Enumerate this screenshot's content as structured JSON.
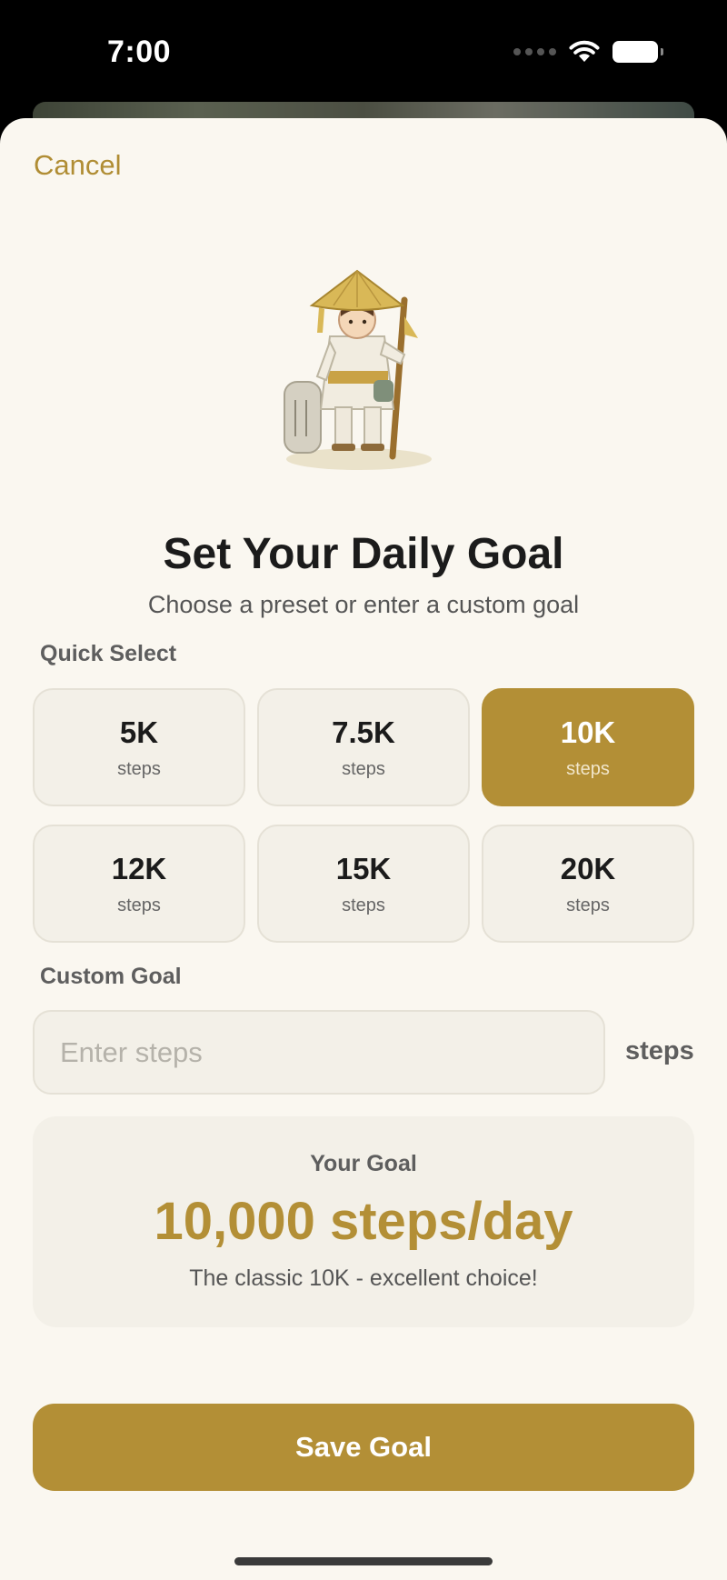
{
  "status_bar": {
    "time": "7:00"
  },
  "sheet": {
    "cancel_label": "Cancel"
  },
  "header": {
    "title": "Set Your Daily Goal",
    "subtitle": "Choose a preset or enter a custom goal"
  },
  "quick_select": {
    "label": "Quick Select",
    "presets": [
      {
        "value": "5K",
        "unit": "steps",
        "selected": false
      },
      {
        "value": "7.5K",
        "unit": "steps",
        "selected": false
      },
      {
        "value": "10K",
        "unit": "steps",
        "selected": true
      },
      {
        "value": "12K",
        "unit": "steps",
        "selected": false
      },
      {
        "value": "15K",
        "unit": "steps",
        "selected": false
      },
      {
        "value": "20K",
        "unit": "steps",
        "selected": false
      }
    ]
  },
  "custom_goal": {
    "label": "Custom Goal",
    "placeholder": "Enter steps",
    "value": "",
    "unit": "steps"
  },
  "goal_summary": {
    "heading": "Your Goal",
    "value": "10,000 steps/day",
    "description": "The classic 10K - excellent choice!"
  },
  "save_label": "Save Goal",
  "colors": {
    "accent": "#b38f36",
    "background": "#faf7f0",
    "card": "#f3f0e8"
  }
}
